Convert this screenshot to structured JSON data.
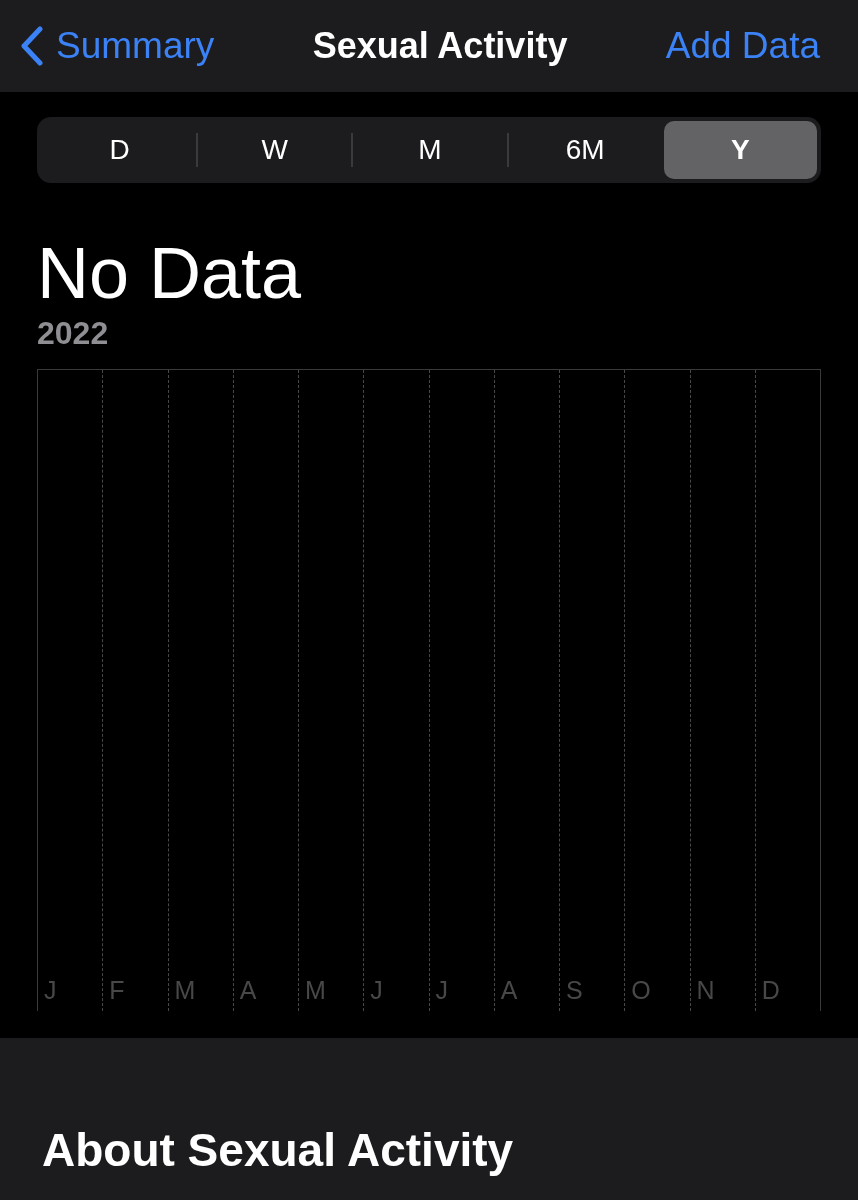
{
  "nav": {
    "back_label": "Summary",
    "title": "Sexual Activity",
    "action": "Add Data"
  },
  "ranges": [
    {
      "label": "D",
      "selected": false
    },
    {
      "label": "W",
      "selected": false
    },
    {
      "label": "M",
      "selected": false
    },
    {
      "label": "6M",
      "selected": false
    },
    {
      "label": "Y",
      "selected": true
    }
  ],
  "summary": {
    "value": "No Data",
    "period": "2022"
  },
  "chart": {
    "month_labels": [
      "J",
      "F",
      "M",
      "A",
      "M",
      "J",
      "J",
      "A",
      "S",
      "O",
      "N",
      "D"
    ]
  },
  "about": {
    "heading": "About Sexual Activity"
  }
}
